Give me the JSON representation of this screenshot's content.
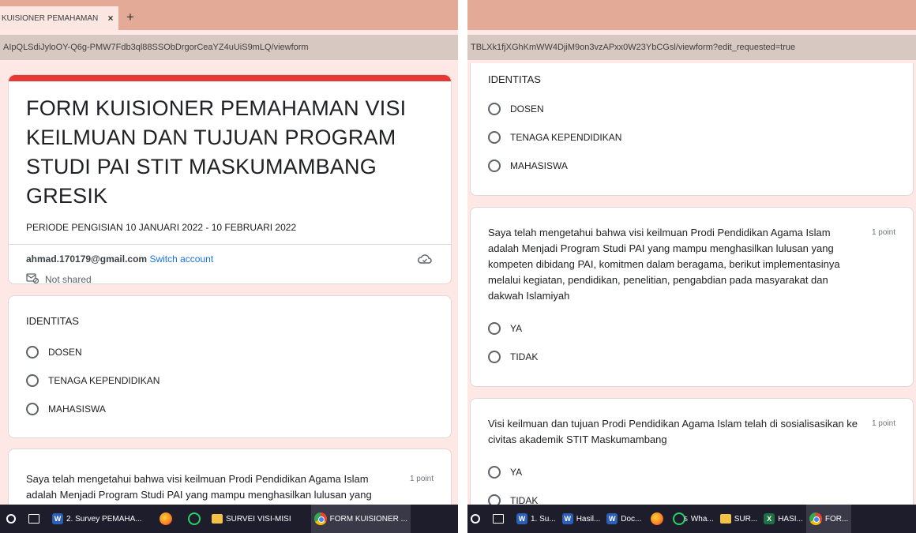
{
  "left": {
    "tab_title": "KUISIONER PEMAHAMAN",
    "tab_close": "×",
    "new_tab": "+",
    "url": "AIpQLSdiJyloOY-Q6g-PMW7Fdb3ql88SSObDrgorCeaYZ4uUiS9mLQ/viewform",
    "form": {
      "title": "FORM KUISIONER PEMAHAMAN VISI KEILMUAN DAN TUJUAN PROGRAM STUDI PAI STIT MASKUMAMBANG GRESIK",
      "description": "PERIODE PENGISIAN 10 JANUARI 2022 - 10 FEBRUARI 2022",
      "email": "ahmad.170179@gmail.com",
      "switch_account": "Switch account",
      "not_shared": "Not shared"
    },
    "identitas": {
      "title": "IDENTITAS",
      "options": [
        "DOSEN",
        "TENAGA KEPENDIDIKAN",
        "MAHASISWA"
      ]
    },
    "q1": {
      "text": "Saya telah mengetahui bahwa visi keilmuan  Prodi Pendidikan Agama Islam adalah Menjadi Program Studi PAI yang mampu menghasilkan lulusan yang kompeten dibidang PAI, komitmen dalam beragama, berikut",
      "points": "1 point"
    },
    "taskbar": {
      "items": [
        "2. Survey PEMAHA...",
        "SURVEI VISI-MISI",
        "FORM KUISIONER ..."
      ]
    }
  },
  "right": {
    "url": "TBLXk1fjXGhKmWW4DjiM9on3vzAPxx0W23YbCGsl/viewform?edit_requested=true",
    "identitas": {
      "title": "IDENTITAS",
      "options": [
        "DOSEN",
        "TENAGA KEPENDIDIKAN",
        "MAHASISWA"
      ]
    },
    "q1": {
      "text": "Saya telah mengetahui bahwa visi keilmuan  Prodi Pendidikan Agama Islam adalah Menjadi Program Studi PAI yang mampu menghasilkan lulusan yang kompeten dibidang PAI, komitmen dalam beragama, berikut implementasinya melalui kegiatan, pendidikan, penelitian, pengabdian pada masyarakat dan dakwah Islamiyah",
      "points": "1 point",
      "options": [
        "YA",
        "TIDAK"
      ]
    },
    "q2": {
      "text": "Visi keilmuan dan tujuan Prodi Pendidikan Agama Islam  telah di sosialisasikan ke civitas akademik STIT Maskumambang",
      "points": "1 point",
      "options": [
        "YA",
        "TIDAK"
      ]
    },
    "taskbar": {
      "items": [
        "1. Su...",
        "Hasil...",
        "Doc...",
        "Wha...",
        "SUR...",
        "HASI...",
        "FOR..."
      ],
      "whatsapp_badge": "5"
    }
  }
}
